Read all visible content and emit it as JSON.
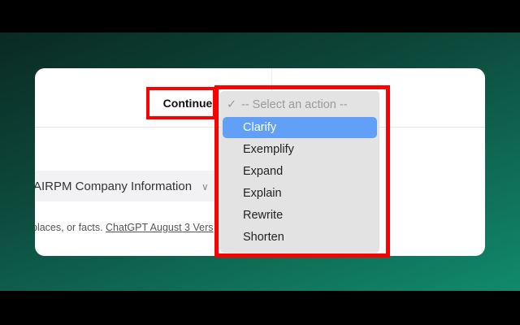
{
  "card": {
    "continue_label": "Continue",
    "info_select_value": "AIRPM Company Information",
    "footnote_prefix": "places, or facts. ",
    "footnote_link": "ChatGPT August 3 Vers"
  },
  "dropdown": {
    "placeholder": "-- Select an action --",
    "selected": "Clarify",
    "options": [
      "Clarify",
      "Exemplify",
      "Expand",
      "Explain",
      "Rewrite",
      "Shorten"
    ]
  },
  "colors": {
    "highlight": "#ff0000",
    "selected_bg": "#62a0f8"
  }
}
